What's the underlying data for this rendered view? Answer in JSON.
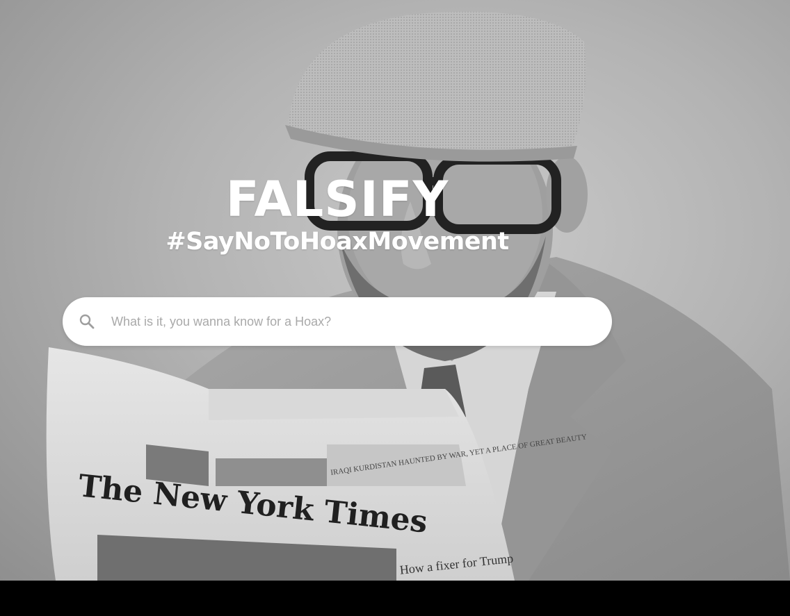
{
  "brand": {
    "title": "FALSIFY",
    "tagline": "#SayNoToHoaxMovement"
  },
  "search": {
    "placeholder": "What is it, you wanna know for a Hoax?",
    "value": "",
    "icon": "search-icon"
  },
  "background": {
    "newspaper_masthead": "The New York Times",
    "headline_right": "IRAQI KURDISTAN HAUNTED BY WAR, YET A PLACE OF GREAT BEAUTY",
    "headline_bottom": "How a fixer for Trump"
  },
  "colors": {
    "overlay_text": "#ffffff",
    "search_bg": "#ffffff",
    "placeholder": "#a9a9a9",
    "footer_bar": "#000000"
  }
}
